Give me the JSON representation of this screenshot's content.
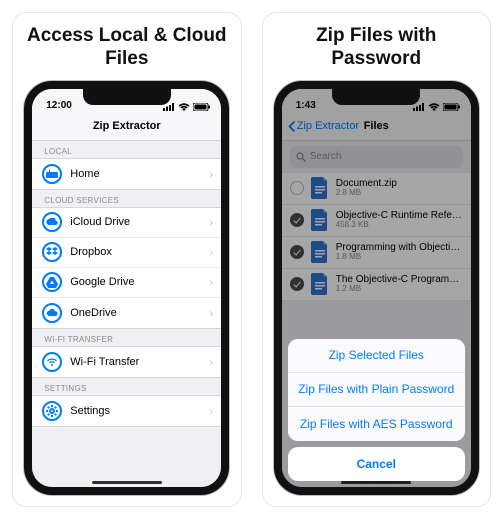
{
  "cards": {
    "left_title": "Access Local & Cloud Files",
    "right_title": "Zip Files with Password"
  },
  "left": {
    "status_time": "12:00",
    "nav_title": "Zip Extractor",
    "sections": {
      "local": {
        "header": "LOCAL",
        "items": [
          {
            "label": "Home",
            "icon": "home"
          }
        ]
      },
      "cloud": {
        "header": "CLOUD SERVICES",
        "items": [
          {
            "label": "iCloud Drive",
            "icon": "cloud"
          },
          {
            "label": "Dropbox",
            "icon": "dropbox"
          },
          {
            "label": "Google Drive",
            "icon": "gdrive"
          },
          {
            "label": "OneDrive",
            "icon": "onedrive"
          }
        ]
      },
      "wifi": {
        "header": "WI-FI TRANSFER",
        "items": [
          {
            "label": "Wi-Fi Transfer",
            "icon": "wifi"
          }
        ]
      },
      "settings": {
        "header": "SETTINGS",
        "items": [
          {
            "label": "Settings",
            "icon": "gear"
          }
        ]
      }
    }
  },
  "right": {
    "status_time": "1:43",
    "nav_back": "Zip Extractor",
    "nav_title": "Files",
    "search_placeholder": "Search",
    "files": [
      {
        "name": "Document.zip",
        "size": "2.8 MB",
        "selected": false
      },
      {
        "name": "Objective-C Runtime Refe…",
        "size": "458.3 KB",
        "selected": true
      },
      {
        "name": "Programming with Objecti…",
        "size": "1.8 MB",
        "selected": true
      },
      {
        "name": "The Objective-C Program…",
        "size": "1.2 MB",
        "selected": true
      }
    ],
    "sheet": {
      "actions": [
        "Zip Selected Files",
        "Zip Files with Plain Password",
        "Zip Files with AES Password"
      ],
      "cancel": "Cancel"
    }
  }
}
